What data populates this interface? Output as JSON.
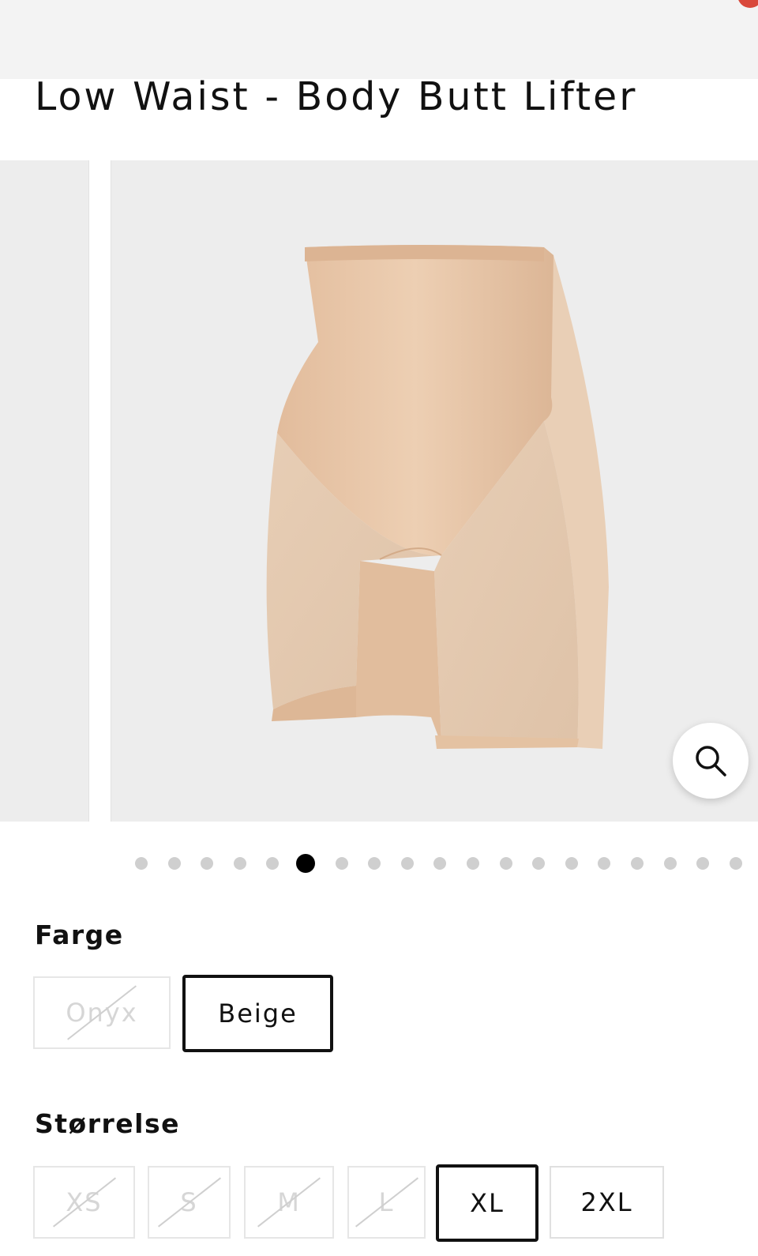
{
  "product": {
    "title": "Low Waist - Body Butt Lifter"
  },
  "gallery": {
    "dot_count": 19,
    "active_index": 5,
    "zoom_icon": "search-icon"
  },
  "color_section": {
    "label": "Farge",
    "options": [
      {
        "label": "Onyx",
        "available": false,
        "selected": false
      },
      {
        "label": "Beige",
        "available": true,
        "selected": true
      }
    ]
  },
  "size_section": {
    "label": "Størrelse",
    "options": [
      {
        "label": "XS",
        "available": false,
        "selected": false
      },
      {
        "label": "S",
        "available": false,
        "selected": false
      },
      {
        "label": "M",
        "available": false,
        "selected": false
      },
      {
        "label": "L",
        "available": false,
        "selected": false
      },
      {
        "label": "XL",
        "available": true,
        "selected": true
      },
      {
        "label": "2XL",
        "available": true,
        "selected": false
      }
    ]
  },
  "colors": {
    "swatch_beige": "#e8c6a8",
    "image_bg": "#ededed",
    "badge": "#d9483b"
  }
}
